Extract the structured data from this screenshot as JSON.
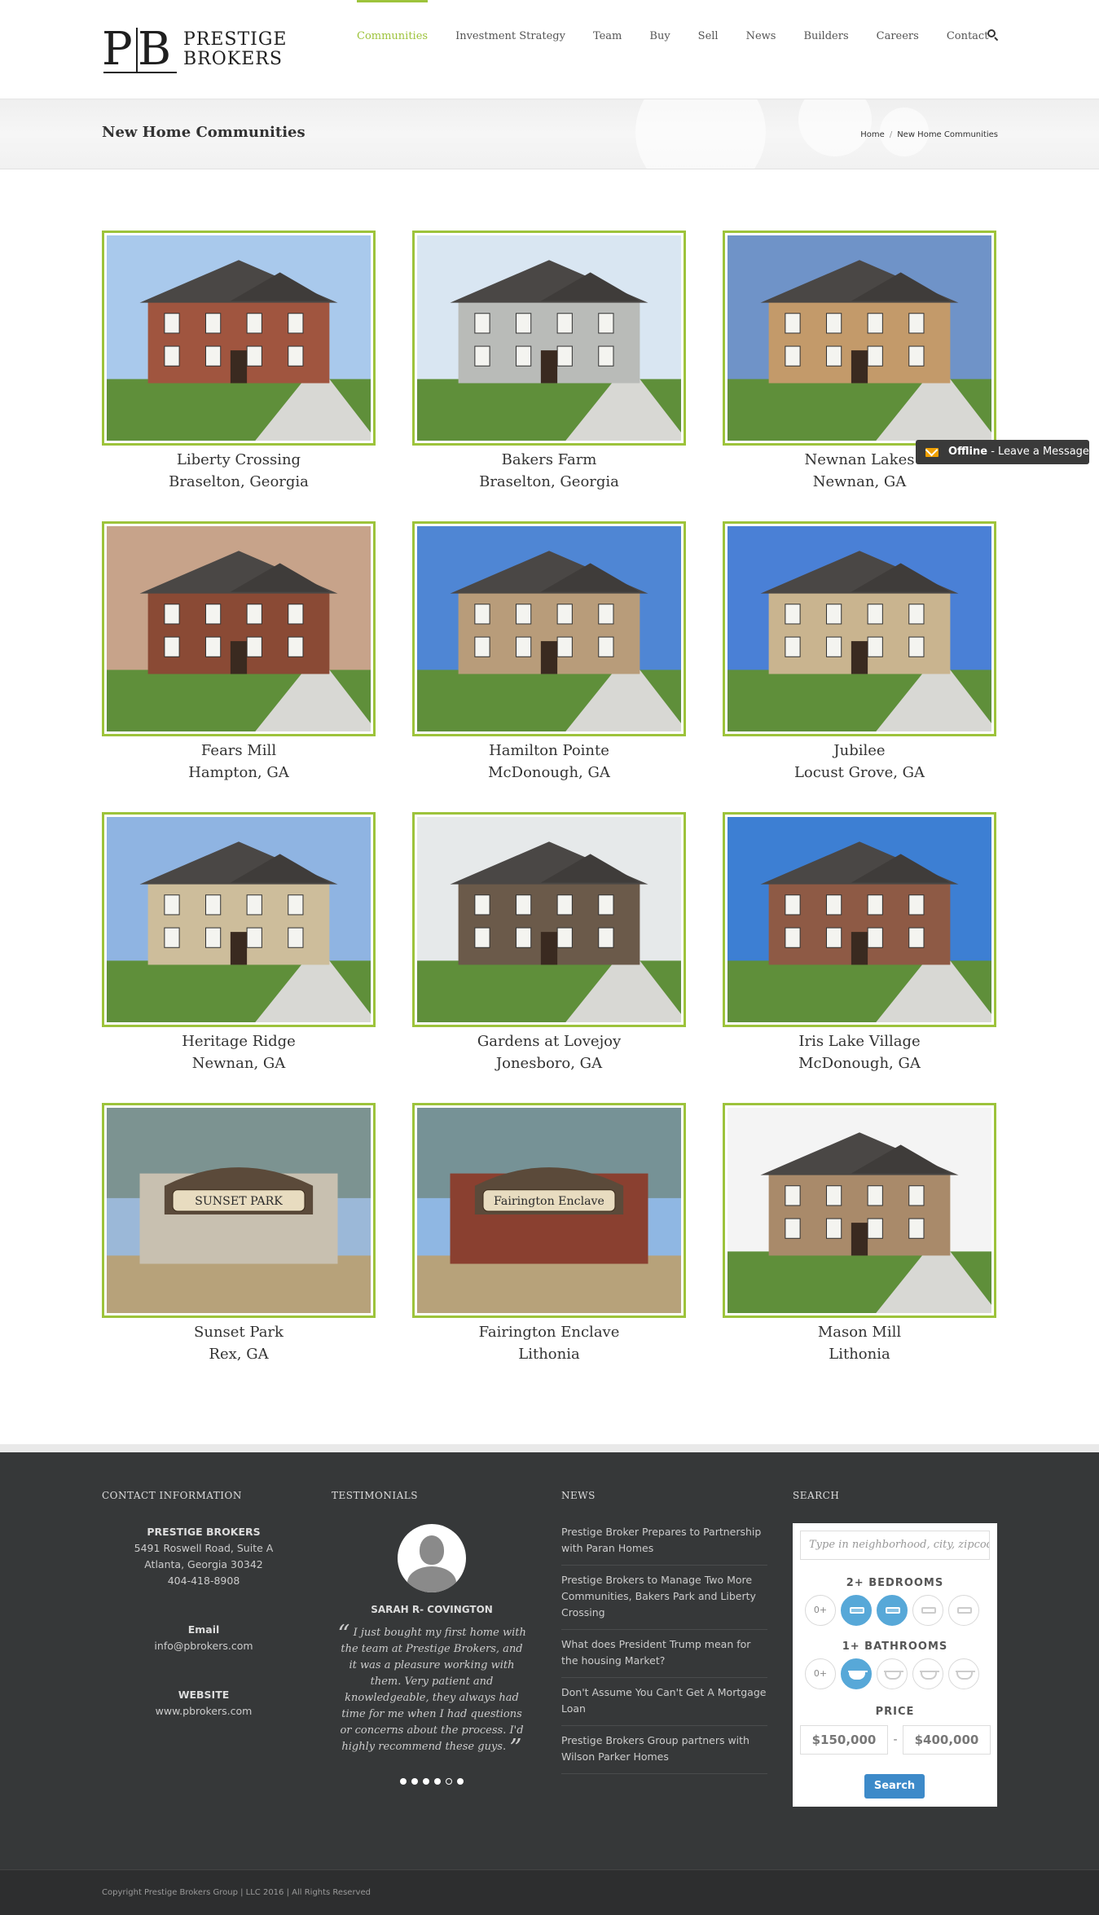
{
  "brand": {
    "mark_p": "P",
    "mark_b": "B",
    "line1": "PRESTIGE",
    "line2": "BROKERS"
  },
  "nav": {
    "items": [
      {
        "label": "Communities",
        "active": true
      },
      {
        "label": "Investment Strategy"
      },
      {
        "label": "Team"
      },
      {
        "label": "Buy"
      },
      {
        "label": "Sell"
      },
      {
        "label": "News"
      },
      {
        "label": "Builders"
      },
      {
        "label": "Careers"
      },
      {
        "label": "Contact"
      }
    ],
    "search_icon": "search-icon"
  },
  "page": {
    "title": "New Home Communities",
    "breadcrumb": [
      "Home",
      "New Home Communities"
    ],
    "breadcrumb_sep": "/"
  },
  "communities": [
    {
      "name": "Liberty Crossing",
      "location": "Braselton, Georgia"
    },
    {
      "name": "Bakers Farm",
      "location": "Braselton, Georgia"
    },
    {
      "name": "Newnan Lakes",
      "location": "Newnan, GA"
    },
    {
      "name": "Fears Mill",
      "location": "Hampton, GA"
    },
    {
      "name": "Hamilton Pointe",
      "location": "McDonough, GA"
    },
    {
      "name": "Jubilee",
      "location": "Locust Grove, GA"
    },
    {
      "name": "Heritage Ridge",
      "location": "Newnan, GA"
    },
    {
      "name": "Gardens at Lovejoy",
      "location": "Jonesboro, GA"
    },
    {
      "name": "Iris Lake Village",
      "location": "McDonough, GA"
    },
    {
      "name": "Sunset Park",
      "location": "Rex, GA",
      "sign": "SUNSET PARK"
    },
    {
      "name": "Fairington Enclave",
      "location": "Lithonia",
      "sign": "Fairington Enclave"
    },
    {
      "name": "Mason Mill",
      "location": "Lithonia"
    }
  ],
  "chat": {
    "status": "Offline",
    "text": " - Leave a Message"
  },
  "footer": {
    "contact": {
      "heading": "CONTACT INFORMATION",
      "company": "PRESTIGE BROKERS",
      "address1": "5491 Roswell Road, Suite A",
      "address2": "Atlanta, Georgia 30342",
      "phone": "404-418-8908",
      "email_label": "Email",
      "email": "info@pbrokers.com",
      "website_label": "WEBSITE",
      "website": "www.pbrokers.com"
    },
    "testimonials": {
      "heading": "TESTIMONIALS",
      "name": "SARAH R- COVINGTON",
      "quote": "I just bought my first home with the team at Prestige Brokers, and it was a pleasure working with them. Very patient and knowledgeable, they always had time for me when I had questions or concerns about the process. I'd highly recommend these guys.",
      "slides": 6,
      "active_slide": 5
    },
    "news": {
      "heading": "NEWS",
      "items": [
        "Prestige Broker Prepares to Partnership with Paran Homes",
        "Prestige Brokers to Manage Two More Communities, Bakers Park and Liberty Crossing",
        "What does President Trump mean for the housing Market?",
        "Don't Assume You Can't Get A Mortgage Loan",
        "Prestige Brokers Group partners with Wilson Parker Homes"
      ]
    },
    "search": {
      "heading": "SEARCH",
      "placeholder": "Type in neighborhood, city, zipcode",
      "bedrooms_label": "2+ BEDROOMS",
      "bathrooms_label": "1+ BATHROOMS",
      "zero_option": "0+",
      "bedrooms_selected": [
        1,
        2
      ],
      "bathrooms_selected": [
        1
      ],
      "price_label": "PRICE",
      "price_min": "$150,000",
      "price_dash": "-",
      "price_max": "$400,000",
      "button": "Search"
    },
    "copyright": "Copyright Prestige Brokers Group | LLC 2016 | All Rights Reserved"
  },
  "colors": {
    "accent": "#9dc33b",
    "footer_bg": "#363839",
    "search_button": "#3d8ac9",
    "selected_option": "#57a8d8"
  }
}
